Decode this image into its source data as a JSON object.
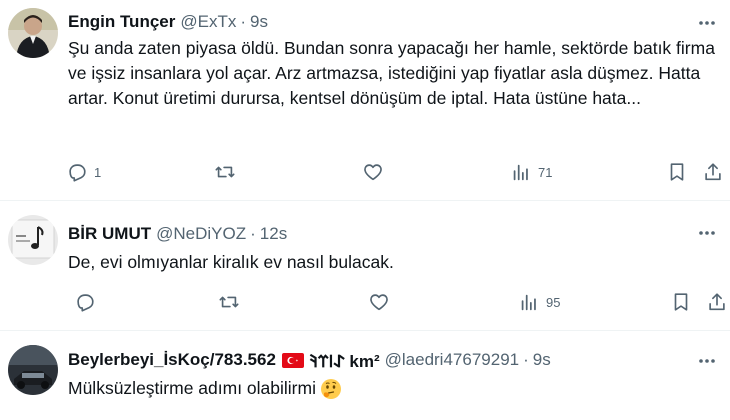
{
  "tweets": [
    {
      "name": "Engin Tunçer",
      "handle": "@ExTx",
      "dot": "·",
      "time": "9s",
      "text": "Şu anda zaten piyasa öldü. Bundan sonra yapacağı her hamle, sektörde batık firma ve işsiz insanlara yol açar. Arz artmazsa, istediğini yap fiyatlar asla düşmez. Hatta artar. Konut üretimi durursa, kentsel dönüşüm de iptal. Hata üstüne hata...",
      "reply_count": "1",
      "retweet_count": "",
      "like_count": "",
      "view_count": "71"
    },
    {
      "name": "BİR UMUT",
      "handle": "@NeDiYOZ",
      "dot": "·",
      "time": "12s",
      "text": "De, evi olmıyanlar kiralık ev nasıl bulacak.",
      "reply_count": "",
      "retweet_count": "",
      "like_count": "",
      "view_count": "95"
    },
    {
      "name": "Beylerbeyi_İsKoç/783.562",
      "name_suffix": "𐰀𐰾𐰼𐰚 km²",
      "handle": "@laedri47679291",
      "dot": "·",
      "time": "9s",
      "text": "Mülksüzleştirme adımı olabilirmi"
    }
  ],
  "icons": {
    "reply": "reply-icon",
    "retweet": "retweet-icon",
    "like": "like-icon",
    "views": "views-icon",
    "bookmark": "bookmark-icon",
    "share": "share-icon",
    "more": "more-icon",
    "flag": "turkey-flag-icon",
    "emoji": "thinking-face-emoji"
  },
  "colors": {
    "text": "#0f1419",
    "secondary": "#536471",
    "separator": "#eff3f4",
    "flag_red": "#e30a17"
  }
}
